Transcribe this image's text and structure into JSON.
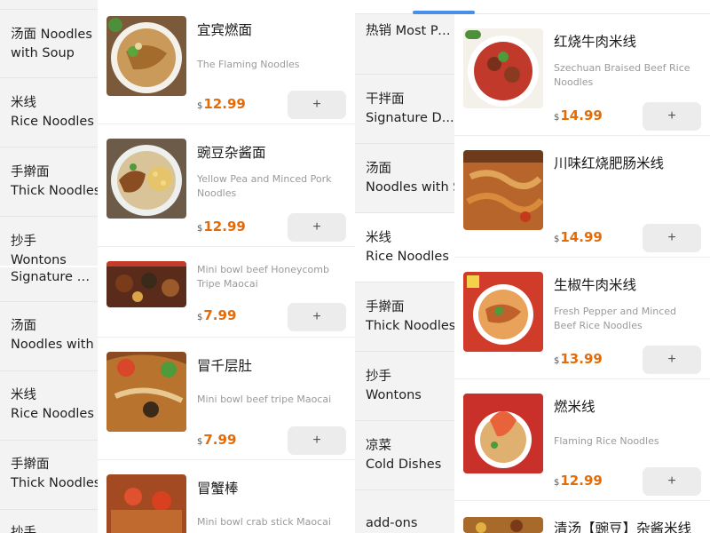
{
  "left_sidebar_items": [
    {
      "label_zh": "汤面",
      "label_en": "Noodles with Soup"
    },
    {
      "label_zh": "米线",
      "label_en": "Rice Noodles"
    },
    {
      "label_zh": "手擀面",
      "label_en": "Thick Noodles"
    },
    {
      "label_zh": "抄手",
      "label_en": "Wontons"
    }
  ],
  "left_sidebar_items_lower": [
    {
      "label_zh": "",
      "label_en": "Signature D..."
    },
    {
      "label_zh": "汤面",
      "label_en": "Noodles with Soup"
    },
    {
      "label_zh": "米线",
      "label_en": "Rice Noodles"
    },
    {
      "label_zh": "手擀面",
      "label_en": "Thick Noodles"
    },
    {
      "label_zh": "抄手",
      "label_en": ""
    }
  ],
  "left_menu_items": [
    {
      "name": "宜宾燃面",
      "desc": "The Flaming Noodles",
      "currency": "$",
      "price": "12.99",
      "add_label": "+"
    },
    {
      "name": "豌豆杂酱面",
      "desc": "Yellow Pea and Minced Pork Noodles",
      "currency": "$",
      "price": "12.99",
      "add_label": "+"
    },
    {
      "name": "",
      "desc": "Mini bowl beef Honeycomb Tripe Maocai",
      "currency": "$",
      "price": "7.99",
      "add_label": "+"
    },
    {
      "name": "冒千层肚",
      "desc": "Mini bowl beef tripe Maocai",
      "currency": "$",
      "price": "7.99",
      "add_label": "+"
    },
    {
      "name": "冒蟹棒",
      "desc": "Mini bowl crab stick Maocai",
      "currency": "$",
      "price": "",
      "add_label": "+"
    }
  ],
  "right_sidebar_items": [
    {
      "label_zh": "热销",
      "label_en": "Most Popular"
    },
    {
      "label_zh": "干拌面",
      "label_en": "Signature D..."
    },
    {
      "label_zh": "汤面",
      "label_en": "Noodles with Soup"
    },
    {
      "label_zh": "米线",
      "label_en": "Rice Noodles"
    },
    {
      "label_zh": "手擀面",
      "label_en": "Thick Noodles"
    },
    {
      "label_zh": "抄手",
      "label_en": "Wontons"
    },
    {
      "label_zh": "凉菜",
      "label_en": "Cold Dishes"
    },
    {
      "label_zh": "",
      "label_en": "add-ons"
    }
  ],
  "right_menu_items": [
    {
      "name": "红烧牛肉米线",
      "desc": "Szechuan Braised Beef Rice Noodles",
      "currency": "$",
      "price": "14.99",
      "add_label": "+"
    },
    {
      "name": "川味红烧肥肠米线",
      "desc": "",
      "currency": "$",
      "price": "14.99",
      "add_label": "+"
    },
    {
      "name": "生椒牛肉米线",
      "desc": "Fresh Pepper and Minced Beef Rice Noodles",
      "currency": "$",
      "price": "13.99",
      "add_label": "+"
    },
    {
      "name": "燃米线",
      "desc": "Flaming Rice Noodles",
      "currency": "$",
      "price": "12.99",
      "add_label": "+"
    },
    {
      "name": "清汤【豌豆】杂酱米线",
      "desc": "",
      "currency": "",
      "price": "",
      "add_label": ""
    }
  ],
  "colors": {
    "accent_price": "#e36c09",
    "tab_indicator": "#4a8fe7",
    "sidebar_bg": "#f3f3f3"
  }
}
